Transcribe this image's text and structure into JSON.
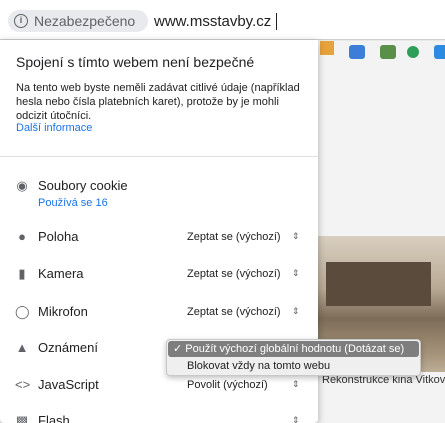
{
  "address_bar": {
    "security_chip": "Nezabezpečeno",
    "url": "www.msstavby.cz"
  },
  "popup": {
    "title": "Spojení s tímto webem není bezpečné",
    "body": "Na tento web byste neměli zadávat citlivé údaje (například hesla nebo čísla platebních karet), protože by je mohli odcizit útočníci.",
    "more_info": "Další informace",
    "cookies": {
      "label": "Soubory cookie",
      "sub": "Používá se 16"
    },
    "permissions": [
      {
        "icon": "location-pin-icon",
        "label": "Poloha",
        "value": "Zeptat se (výchozí)"
      },
      {
        "icon": "camera-icon",
        "label": "Kamera",
        "value": "Zeptat se (výchozí)"
      },
      {
        "icon": "microphone-icon",
        "label": "Mikrofon",
        "value": "Zeptat se (výchozí)"
      },
      {
        "icon": "bell-icon",
        "label": "Oznámení",
        "value": ""
      },
      {
        "icon": "code-icon",
        "label": "JavaScript",
        "value": "Povolit (výchozí)"
      },
      {
        "icon": "puzzle-icon",
        "label": "Flash",
        "value": ""
      }
    ]
  },
  "notification_menu": {
    "selected": "Použít výchozí globální hodnotu (Dotázat se)",
    "other": "Blokovat vždy na tomto webu"
  },
  "background_page": {
    "caption": "Rekonstrukce kina Vitkov"
  },
  "colors": {
    "link": "#1a73e8",
    "menu_selected": "#7e7e7e"
  }
}
